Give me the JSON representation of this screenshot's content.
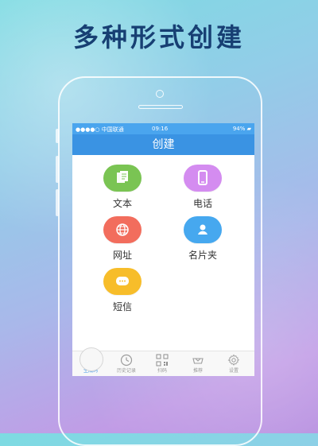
{
  "headline": "多种形式创建",
  "status_bar": {
    "carrier": "●●●●○ 中国联通",
    "time": "09:16",
    "battery": "94%"
  },
  "nav": {
    "title": "创建"
  },
  "actions": [
    {
      "label": "文本"
    },
    {
      "label": "电话"
    },
    {
      "label": "网址"
    },
    {
      "label": "名片夹"
    },
    {
      "label": "短信"
    }
  ],
  "tabs": [
    {
      "label": "生成码"
    },
    {
      "label": "历史记录"
    },
    {
      "label": "扫码"
    },
    {
      "label": "推荐"
    },
    {
      "label": "设置"
    }
  ]
}
